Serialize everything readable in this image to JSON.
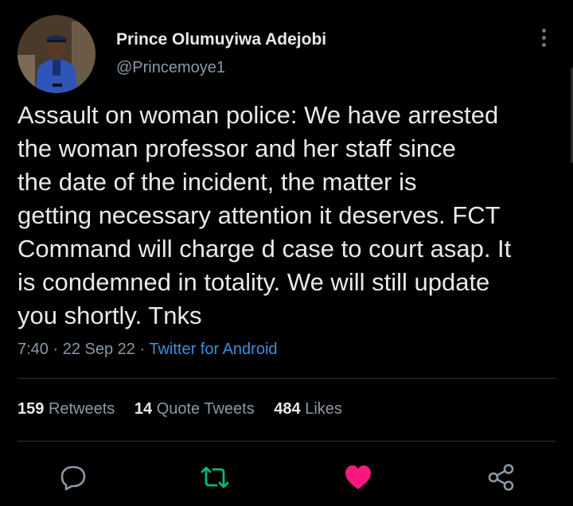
{
  "author": {
    "name": "Prince Olumuyiwa Adejobi",
    "handle": "@Princemoye1"
  },
  "tweet": {
    "text": "Assault on woman police: We have arrested\nthe woman professor and her staff since\nthe date of the incident, the matter is\ngetting necessary attention it deserves. FCT\nCommand will charge d case to court asap. It\nis condemned in totality. We will still update\nyou shortly. Tnks",
    "time": "7:40",
    "date": "22 Sep 22",
    "source": "Twitter for Android"
  },
  "stats": {
    "retweets_count": "159",
    "retweets_label": "Retweets",
    "quotes_count": "14",
    "quotes_label": "Quote Tweets",
    "likes_count": "484",
    "likes_label": "Likes"
  },
  "actions": {
    "reply_icon": "reply-icon",
    "retweet_icon": "retweet-icon",
    "like_icon": "heart-icon",
    "share_icon": "share-icon",
    "retweet_color": "#00ba7c",
    "like_color": "#f91880"
  },
  "colors": {
    "background": "#000000",
    "text": "#e7e9ea",
    "secondary": "#8b98a5",
    "link": "#3b8fd9"
  }
}
